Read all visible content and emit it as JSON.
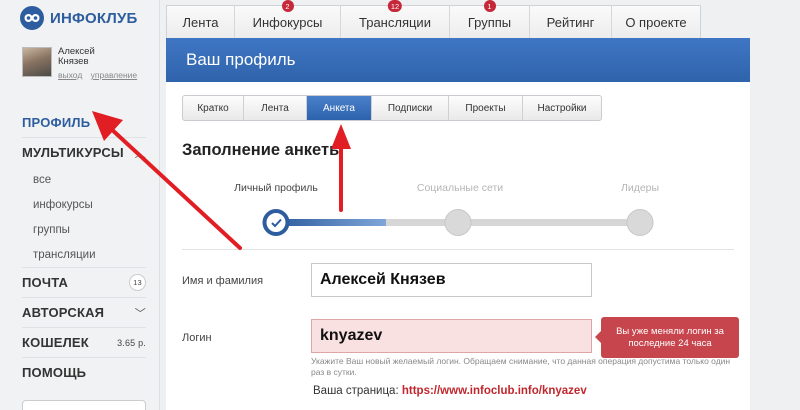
{
  "brand": {
    "name": "ИНФОКЛУБ"
  },
  "user": {
    "name_line1": "Алексей",
    "name_line2": "Князев",
    "logout": "выход",
    "manage": "управление"
  },
  "sidebar": {
    "items": [
      {
        "label": "ПРОФИЛЬ"
      },
      {
        "label": "МУЛЬТИКУРСЫ"
      },
      {
        "label": "ПОЧТА",
        "badge": "13"
      },
      {
        "label": "АВТОРСКАЯ"
      },
      {
        "label": "КОШЕЛЕК",
        "value": "3.65 р."
      },
      {
        "label": "ПОМОЩЬ"
      }
    ],
    "sub": [
      "все",
      "инфокурсы",
      "группы",
      "трансляции"
    ]
  },
  "top_tabs": [
    {
      "label": "Лента"
    },
    {
      "label": "Инфокурсы",
      "count": "2"
    },
    {
      "label": "Трансляции",
      "count": "12"
    },
    {
      "label": "Группы",
      "count": "1"
    },
    {
      "label": "Рейтинг"
    },
    {
      "label": "О проекте"
    }
  ],
  "panel": {
    "title": "Ваш профиль"
  },
  "sub_tabs": [
    {
      "label": "Кратко"
    },
    {
      "label": "Лента"
    },
    {
      "label": "Анкета",
      "active": true
    },
    {
      "label": "Подписки"
    },
    {
      "label": "Проекты"
    },
    {
      "label": "Настройки"
    }
  ],
  "form": {
    "title": "Заполнение анкеты",
    "steps": [
      "Личный профиль",
      "Социальные сети",
      "Лидеры"
    ],
    "name_label": "Имя и фамилия",
    "name_value": "Алексей Князев",
    "login_label": "Логин",
    "login_value": "knyazev",
    "login_error": "Вы уже меняли логин за последние 24 часа",
    "login_hint": "Укажите Ваш новый желаемый логин. Обращаем снимание, что данная операция допустима только один раз в сутки.",
    "page_prefix": "Ваша страница:",
    "page_url": "https://www.infoclub.info/knyazev"
  },
  "colors": {
    "brand": "#2d5d9f",
    "header": "#3469b5",
    "badge": "#c6283a",
    "arrow": "#e01e24",
    "error": "#c7454d"
  }
}
